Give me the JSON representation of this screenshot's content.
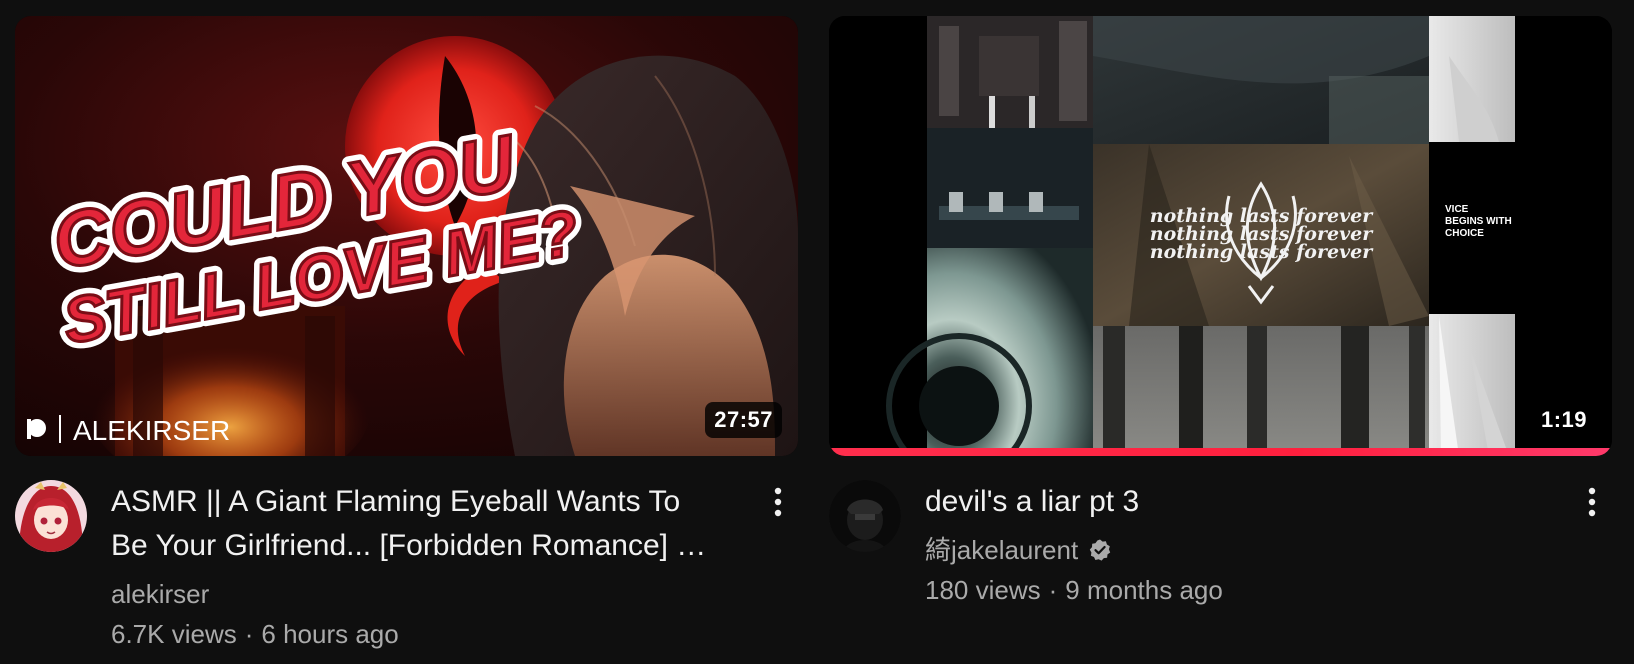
{
  "videos": [
    {
      "duration": "27:57",
      "thumbnail_text": {
        "line1": "COULD YOU",
        "line2": "STILL LOVE ME?",
        "watermark": "ALEKIRSER"
      },
      "title": "ASMR || A Giant Flaming Eyeball Wants To Be Your Girlfriend... [Forbidden Romance] …",
      "channel": "alekirser",
      "views": "6.7K views",
      "separator": "·",
      "age": "6 hours ago",
      "menu_icon": "more-vert-icon"
    },
    {
      "duration": "1:19",
      "watch_progress": 1.0,
      "thumbnail_text": {
        "gothic_lines": [
          "nothing lasts forever",
          "nothing lasts forever",
          "nothing lasts forever"
        ],
        "vice": [
          "VICE",
          "BEGINS WITH",
          "CHOICE"
        ]
      },
      "title": "devil's a liar pt 3",
      "channel": "綺jakelaurent",
      "views": "180 views",
      "separator": "·",
      "age": "9 months ago",
      "verified_icon": "verified-badge-icon",
      "menu_icon": "more-vert-icon"
    }
  ],
  "colors": {
    "background": "#0f0f0f",
    "title": "#f1f1f1",
    "secondary": "#aaaaaa",
    "progress": "#ff1f3d"
  }
}
